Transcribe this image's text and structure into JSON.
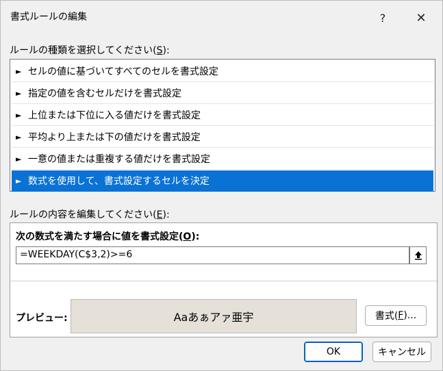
{
  "window": {
    "title": "書式ルールの編集",
    "help": "?",
    "close": "✕"
  },
  "rule_type": {
    "label_pre": "ルールの種類を選択してください(",
    "label_key": "S",
    "label_post": "):",
    "items": [
      {
        "label": "セルの値に基づいてすべてのセルを書式設定",
        "selected": false
      },
      {
        "label": "指定の値を含むセルだけを書式設定",
        "selected": false
      },
      {
        "label": "上位または下位に入る値だけを書式設定",
        "selected": false
      },
      {
        "label": "平均より上または下の値だけを書式設定",
        "selected": false
      },
      {
        "label": "一意の値または重複する値だけを書式設定",
        "selected": false
      },
      {
        "label": "数式を使用して、書式設定するセルを決定",
        "selected": true
      }
    ],
    "arrow": "►"
  },
  "rule_edit": {
    "label_pre": "ルールの内容を編集してください(",
    "label_key": "E",
    "label_post": "):",
    "formula_label_pre": "次の数式を満たす場合に値を書式設定(",
    "formula_label_key": "O",
    "formula_label_post": "):",
    "formula_value": "=WEEKDAY(C$3,2)>=6",
    "preview_label": "プレビュー:",
    "preview_text": "Aaあぁアァ亜宇",
    "format_button_pre": "書式(",
    "format_button_key": "F",
    "format_button_post": ")..."
  },
  "buttons": {
    "ok": "OK",
    "cancel": "キャンセル"
  },
  "colors": {
    "selection": "#0a72d4",
    "preview_bg": "#e6e1d8"
  }
}
